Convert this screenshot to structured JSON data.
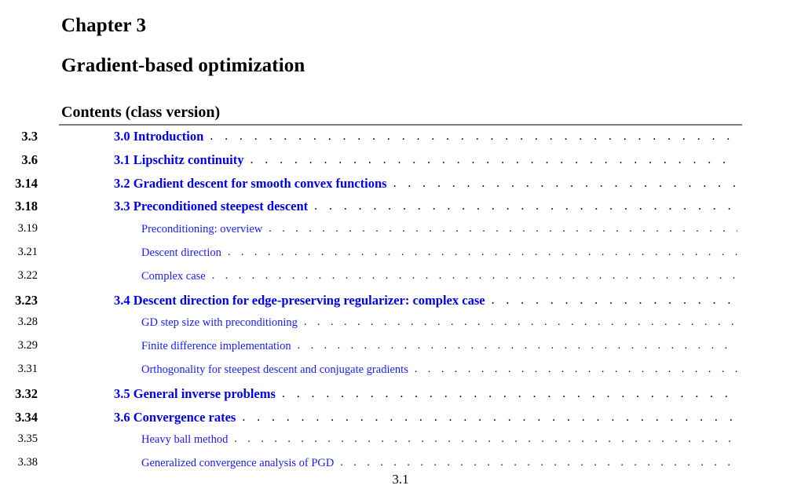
{
  "document": {
    "chapter_label": "Chapter 3",
    "chapter_title": "Gradient-based optimization",
    "contents_heading": "Contents (class version)",
    "footer_page": "3.1",
    "colors": {
      "link_blue": "#0000f0",
      "rule_gray": "#808080",
      "text_black": "#000000"
    }
  },
  "toc": {
    "leader_dots": ". . . . . . . . . . . . . . . . . . . . . . . . . . . . . . . . . . . . . . . . . . . . . . . . . . . . . . . . . . . . . . . . . . . . . . . . . . . . . . . . . . . . . . . . . . . . . . . .",
    "entries": [
      {
        "level": "section",
        "label": "3.0 Introduction",
        "page": "3.3"
      },
      {
        "level": "section",
        "label": "3.1 Lipschitz continuity",
        "page": "3.6"
      },
      {
        "level": "section",
        "label": "3.2 Gradient descent for smooth convex functions",
        "page": "3.14"
      },
      {
        "level": "section",
        "label": "3.3 Preconditioned steepest descent",
        "page": "3.18"
      },
      {
        "level": "subsection",
        "label": "Preconditioning: overview",
        "page": "3.19"
      },
      {
        "level": "subsection",
        "label": "Descent direction",
        "page": "3.21"
      },
      {
        "level": "subsection",
        "label": "Complex case",
        "page": "3.22"
      },
      {
        "level": "section",
        "label": "3.4 Descent direction for edge-preserving regularizer: complex case",
        "page": "3.23"
      },
      {
        "level": "subsection",
        "label": "GD step size with preconditioning",
        "page": "3.28"
      },
      {
        "level": "subsection",
        "label": "Finite difference implementation",
        "page": "3.29"
      },
      {
        "level": "subsection",
        "label": "Orthogonality for steepest descent and conjugate gradients",
        "page": "3.31"
      },
      {
        "level": "section",
        "label": "3.5 General inverse problems",
        "page": "3.32"
      },
      {
        "level": "section",
        "label": "3.6 Convergence rates",
        "page": "3.34"
      },
      {
        "level": "subsection",
        "label": "Heavy ball method",
        "page": "3.35"
      },
      {
        "level": "subsection",
        "label": "Generalized convergence analysis of PGD",
        "page": "3.38"
      }
    ]
  }
}
